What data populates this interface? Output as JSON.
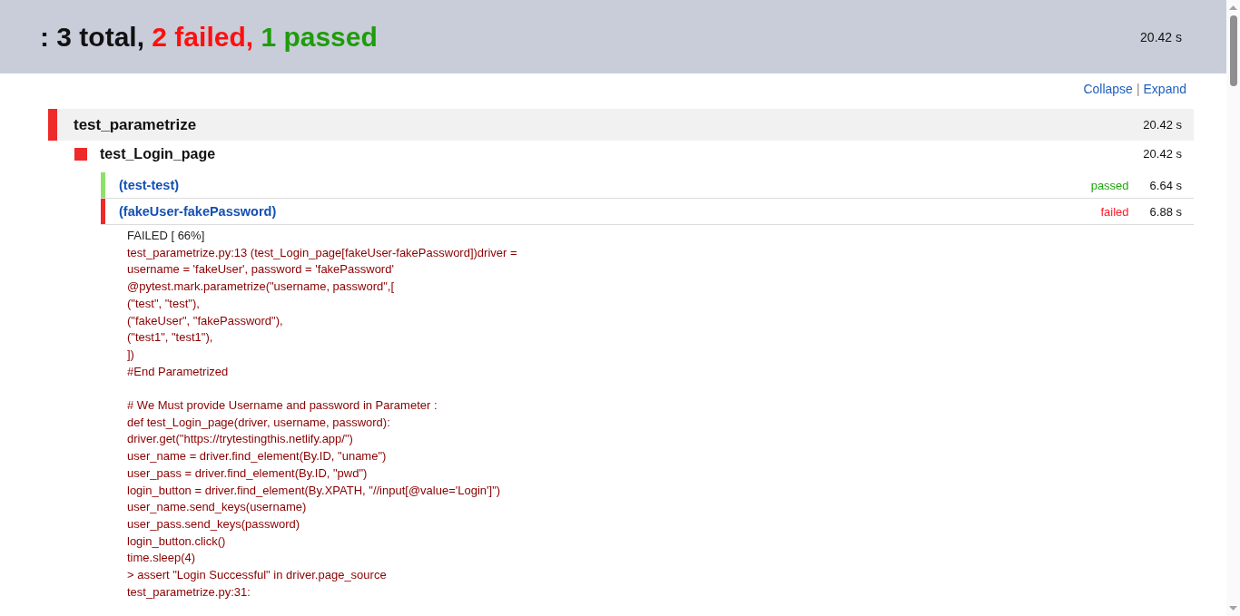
{
  "summary": {
    "parts": [
      {
        "kind": "total",
        "text": ": 3 total,"
      },
      {
        "kind": "failed",
        "text": "2 failed,"
      },
      {
        "kind": "passed",
        "text": "1 passed"
      }
    ],
    "duration": "20.42 s"
  },
  "view_links": [
    {
      "label": "Collapse"
    },
    {
      "label": "Expand"
    }
  ],
  "view_links_separator": "|",
  "suite": {
    "name": "test_parametrize",
    "passed": false,
    "duration": "20.42 s",
    "tests": [
      {
        "name": "test_Login_page",
        "passed": false,
        "duration": "20.42 s",
        "cases": [
          {
            "name": "(test-test)",
            "passed": true,
            "result": "passed",
            "duration": "6.64 s"
          },
          {
            "name": "(fakeUser-fakePassword)",
            "passed": false,
            "result": "failed",
            "duration": "6.88 s",
            "log": {
              "status_line": "FAILED [ 66%]",
              "blocks": [
                [
                  "test_parametrize.py:13 (test_Login_page[fakeUser-fakePassword])driver =",
                  "username = 'fakeUser', password = 'fakePassword'",
                  "@pytest.mark.parametrize(\"username, password\",[",
                  "(\"test\", \"test\"),",
                  "(\"fakeUser\", \"fakePassword\"),",
                  "(\"test1\", \"test1\"),",
                  "])",
                  "#End Parametrized"
                ],
                [
                  "# We Must provide Username and password in Parameter :",
                  "def test_Login_page(driver, username, password):",
                  "driver.get(\"https://trytestingthis.netlify.app/\")",
                  "user_name = driver.find_element(By.ID, \"uname\")",
                  "user_pass = driver.find_element(By.ID, \"pwd\")",
                  "login_button = driver.find_element(By.XPATH, \"//input[@value='Login']\")",
                  "user_name.send_keys(username)",
                  "user_pass.send_keys(password)",
                  "login_button.click()",
                  "time.sleep(4)",
                  "> assert \"Login Successful\" in driver.page_source",
                  "test_parametrize.py:31:"
                ]
              ]
            }
          }
        ]
      }
    ]
  }
}
